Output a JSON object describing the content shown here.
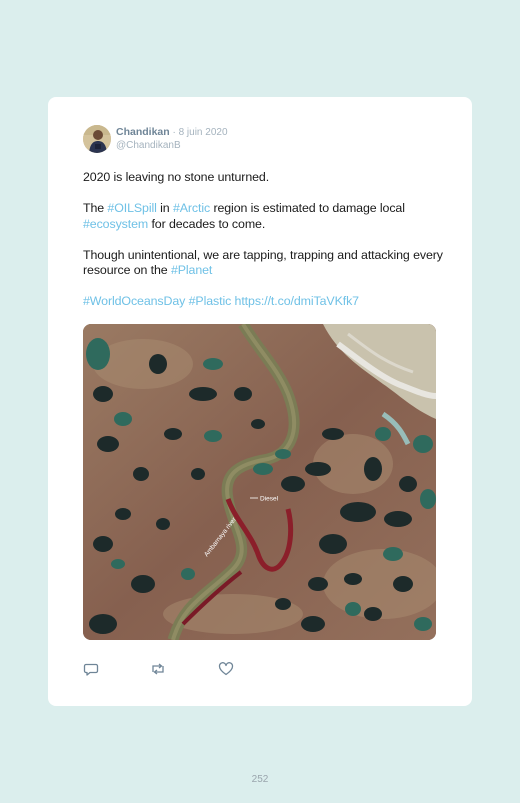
{
  "tweet": {
    "author_name": "Chandikan",
    "date": " · 8 juin 2020",
    "handle": "@ChandikanB",
    "line1": "2020 is leaving no stone unturned.",
    "p2": {
      "t1": "The ",
      "tag1": "#OILSpill",
      "t2": " in ",
      "tag2": "#Arctic",
      "t3": " region is estimated to damage local ",
      "tag3": "#ecosystem",
      "t4": " for decades to come."
    },
    "p3": {
      "t1": "Though unintentional, we are tapping, trapping and attacking every resource on the ",
      "tag1": "#Planet"
    },
    "p4": {
      "tag1": "#WorldOceansDay",
      "tag2": "#Plastic",
      "link": "https://t.co/dmiTaVKfk7"
    },
    "image_labels": {
      "diesel": "Diesel",
      "river": "Ambarnaya river"
    }
  },
  "actions": {
    "reply_icon": "reply-icon",
    "retweet_icon": "retweet-icon",
    "like_icon": "heart-icon"
  },
  "page_number": "252",
  "colors": {
    "background": "#dbeeed",
    "card": "#ffffff",
    "hashtag": "#6fc1e6",
    "name": "#6f8597",
    "muted": "#a5b3be"
  }
}
